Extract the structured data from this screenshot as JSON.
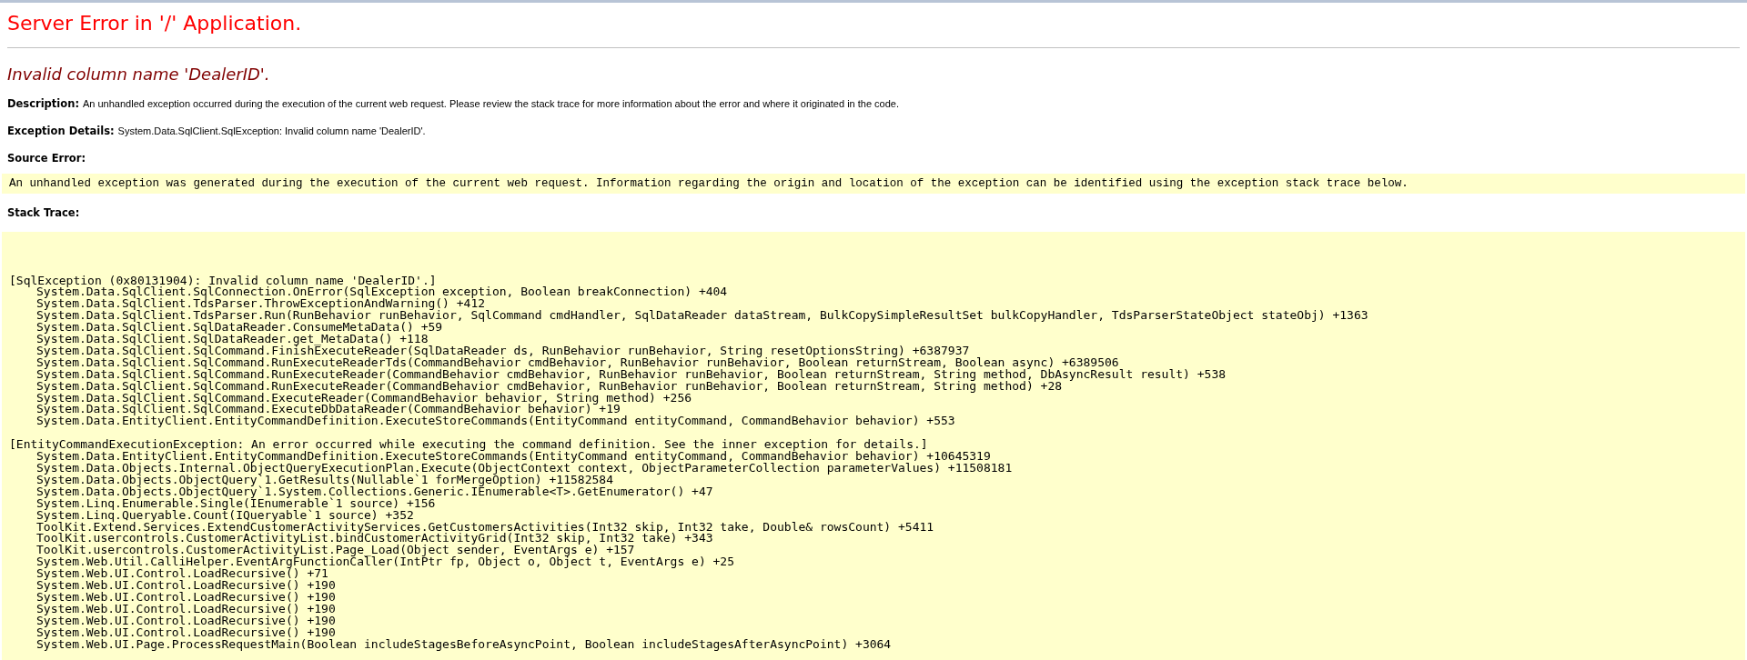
{
  "title": "Server Error in '/' Application.",
  "heading": "Invalid column name 'DealerID'.",
  "description": {
    "label": "Description:",
    "text": "An unhandled exception occurred during the execution of the current web request. Please review the stack trace for more information about the error and where it originated in the code."
  },
  "exception_details": {
    "label": "Exception Details:",
    "text": "System.Data.SqlClient.SqlException: Invalid column name 'DealerID'."
  },
  "source_error": {
    "label": "Source Error:",
    "text": "An unhandled exception was generated during the execution of the current web request. Information regarding the origin and location of the exception can be identified using the exception stack trace below."
  },
  "stack_trace": {
    "label": "Stack Trace:",
    "groups": [
      {
        "header": "[SqlException (0x80131904): Invalid column name 'DealerID'.]",
        "frames": [
          "System.Data.SqlClient.SqlConnection.OnError(SqlException exception, Boolean breakConnection) +404",
          "System.Data.SqlClient.TdsParser.ThrowExceptionAndWarning() +412",
          "System.Data.SqlClient.TdsParser.Run(RunBehavior runBehavior, SqlCommand cmdHandler, SqlDataReader dataStream, BulkCopySimpleResultSet bulkCopyHandler, TdsParserStateObject stateObj) +1363",
          "System.Data.SqlClient.SqlDataReader.ConsumeMetaData() +59",
          "System.Data.SqlClient.SqlDataReader.get_MetaData() +118",
          "System.Data.SqlClient.SqlCommand.FinishExecuteReader(SqlDataReader ds, RunBehavior runBehavior, String resetOptionsString) +6387937",
          "System.Data.SqlClient.SqlCommand.RunExecuteReaderTds(CommandBehavior cmdBehavior, RunBehavior runBehavior, Boolean returnStream, Boolean async) +6389506",
          "System.Data.SqlClient.SqlCommand.RunExecuteReader(CommandBehavior cmdBehavior, RunBehavior runBehavior, Boolean returnStream, String method, DbAsyncResult result) +538",
          "System.Data.SqlClient.SqlCommand.RunExecuteReader(CommandBehavior cmdBehavior, RunBehavior runBehavior, Boolean returnStream, String method) +28",
          "System.Data.SqlClient.SqlCommand.ExecuteReader(CommandBehavior behavior, String method) +256",
          "System.Data.SqlClient.SqlCommand.ExecuteDbDataReader(CommandBehavior behavior) +19",
          "System.Data.EntityClient.EntityCommandDefinition.ExecuteStoreCommands(EntityCommand entityCommand, CommandBehavior behavior) +553"
        ]
      },
      {
        "header": "[EntityCommandExecutionException: An error occurred while executing the command definition. See the inner exception for details.]",
        "frames": [
          "System.Data.EntityClient.EntityCommandDefinition.ExecuteStoreCommands(EntityCommand entityCommand, CommandBehavior behavior) +10645319",
          "System.Data.Objects.Internal.ObjectQueryExecutionPlan.Execute(ObjectContext context, ObjectParameterCollection parameterValues) +11508181",
          "System.Data.Objects.ObjectQuery`1.GetResults(Nullable`1 forMergeOption) +11582584",
          "System.Data.Objects.ObjectQuery`1.System.Collections.Generic.IEnumerable<T>.GetEnumerator() +47",
          "System.Linq.Enumerable.Single(IEnumerable`1 source) +156",
          "System.Linq.Queryable.Count(IQueryable`1 source) +352",
          "ToolKit.Extend.Services.ExtendCustomerActivityServices.GetCustomersActivities(Int32 skip, Int32 take, Double& rowsCount) +5411",
          "ToolKit.usercontrols.CustomerActivityList.bindCustomerActivityGrid(Int32 skip, Int32 take) +343",
          "ToolKit.usercontrols.CustomerActivityList.Page_Load(Object sender, EventArgs e) +157",
          "System.Web.Util.CalliHelper.EventArgFunctionCaller(IntPtr fp, Object o, Object t, EventArgs e) +25",
          "System.Web.UI.Control.LoadRecursive() +71",
          "System.Web.UI.Control.LoadRecursive() +190",
          "System.Web.UI.Control.LoadRecursive() +190",
          "System.Web.UI.Control.LoadRecursive() +190",
          "System.Web.UI.Control.LoadRecursive() +190",
          "System.Web.UI.Control.LoadRecursive() +190",
          "System.Web.UI.Page.ProcessRequestMain(Boolean includeStagesBeforeAsyncPoint, Boolean includeStagesAfterAsyncPoint) +3064"
        ]
      }
    ]
  }
}
